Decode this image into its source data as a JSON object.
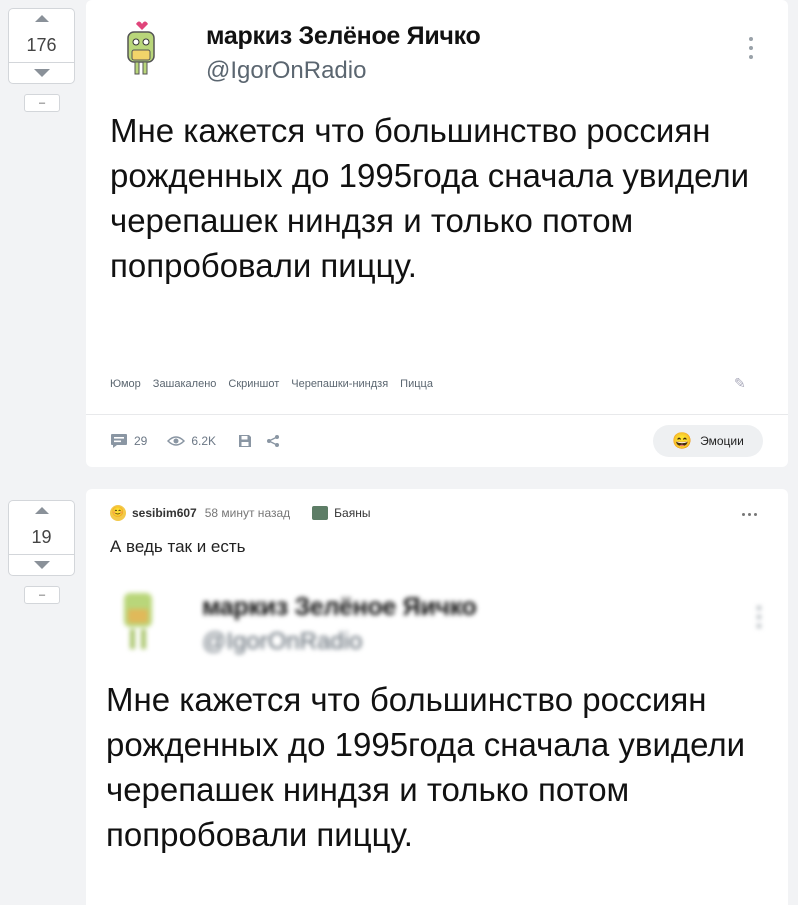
{
  "post1": {
    "rating": "176",
    "minus_label": "–",
    "tweet": {
      "name": "маркиз Зелёное Яичко",
      "handle": "@IgorOnRadio",
      "text": "Мне кажется что большинство россиян рожденных до 1995года сначала увидели черепашек ниндзя и только потом попробовали пиццу."
    },
    "tags": [
      "Юмор",
      "Зашакалено",
      "Скриншот",
      "Черепашки-ниндзя",
      "Пицца"
    ],
    "actions": {
      "comments": "29",
      "views": "6.2K"
    },
    "emotions_label": "Эмоции"
  },
  "post2": {
    "rating": "19",
    "minus_label": "–",
    "author": "sesibim607",
    "time": "58 минут назад",
    "community": "Баяны",
    "caption": "А ведь так и есть",
    "tweet": {
      "name": "маркиз Зелёное Яичко",
      "handle": "@IgorOnRadio",
      "text": "Мне кажется что большинство россиян рожденных до 1995года сначала увидели черепашек ниндзя и только потом попробовали пиццу."
    }
  }
}
